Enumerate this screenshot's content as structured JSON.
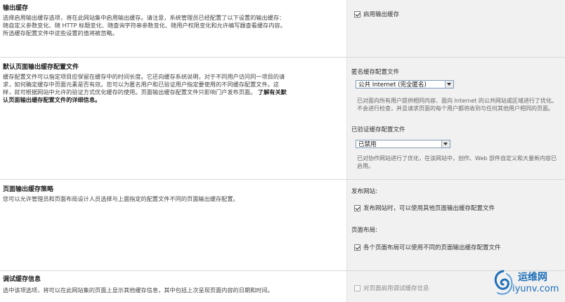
{
  "sections": {
    "output_cache": {
      "title": "输出缓存",
      "description": "选择启用输出缓存选项，将在此网站集中启用输出缓存。请注意，系统管理员已经配置了以下设置的输出缓存：随自定义参数变化、随 HTTP 标题变化、随查询字符串参数变化、随用户权限变化和允许编写器查看缓存内容。所选缓存配置文件中这些设置的值将被忽略。",
      "checkbox_label": "启用输出缓存",
      "checked": true
    },
    "default_page_profile": {
      "title": "默认页面输出缓存配置文件",
      "description": "缓存配置文件可以指定项目应保留在缓存中的时间长度。它还向缓存系统说明，对于不同用户访问同一项目的请求，如何确定缓存中页面元素是否有效。您可以为匿名用户和已验证用户指定要使用的不同缓存配置文件。这样，就可根据网站中允许的验证方式优化缓存的使用。页面输出缓存配置文件只影响门户发布页面。",
      "link_text": "了解有关默认页面输出缓存配置文件的详细信息。",
      "anonymous_label": "匿名缓存配置文件",
      "anonymous_value": "公共 Internet (完全匿名)",
      "anonymous_note": "已对面向所有用户提供相同内容、面向 Internet 的公共网站或区域进行了优化。不会进行检查，并且请求页面的每个用户都将收到与任何其他用户相同的页面。",
      "authenticated_label": "已验证缓存配置文件",
      "authenticated_value": "已禁用",
      "authenticated_note": "已对协作网站进行了优化，在该网站中，创作、Web 部件自定义和大量新内容已启用。"
    },
    "page_policy": {
      "title": "页面输出缓存策略",
      "description": "您可以允许管理员和页面布局设计人员选择与上面指定的配置文件不同的页面输出缓存配置。",
      "publishing_label": "发布网站:",
      "publishing_checkbox": "发布网站时，可以使用其他页面输出缓存配置文件",
      "publishing_checked": true,
      "layout_label": "页面布局:",
      "layout_checkbox": "各个页面布局可以使用不同的页面输出缓存配置文件",
      "layout_checked": true
    },
    "debug_info": {
      "title": "调试缓存信息",
      "description": "选中该项选项，将可以在此网站集的页面上显示其他缓存信息，其中包括上次呈现页面内容的日期和时间。",
      "checkbox_label": "对页面启用调试缓存信息",
      "checked": false
    }
  },
  "watermark": {
    "line1": "运维网",
    "line2": "iyunv.com"
  },
  "colors": {
    "right_panel_bg": "#f1f1f1",
    "divider": "#d8d8d8",
    "watermark": "#1e6fb8"
  }
}
